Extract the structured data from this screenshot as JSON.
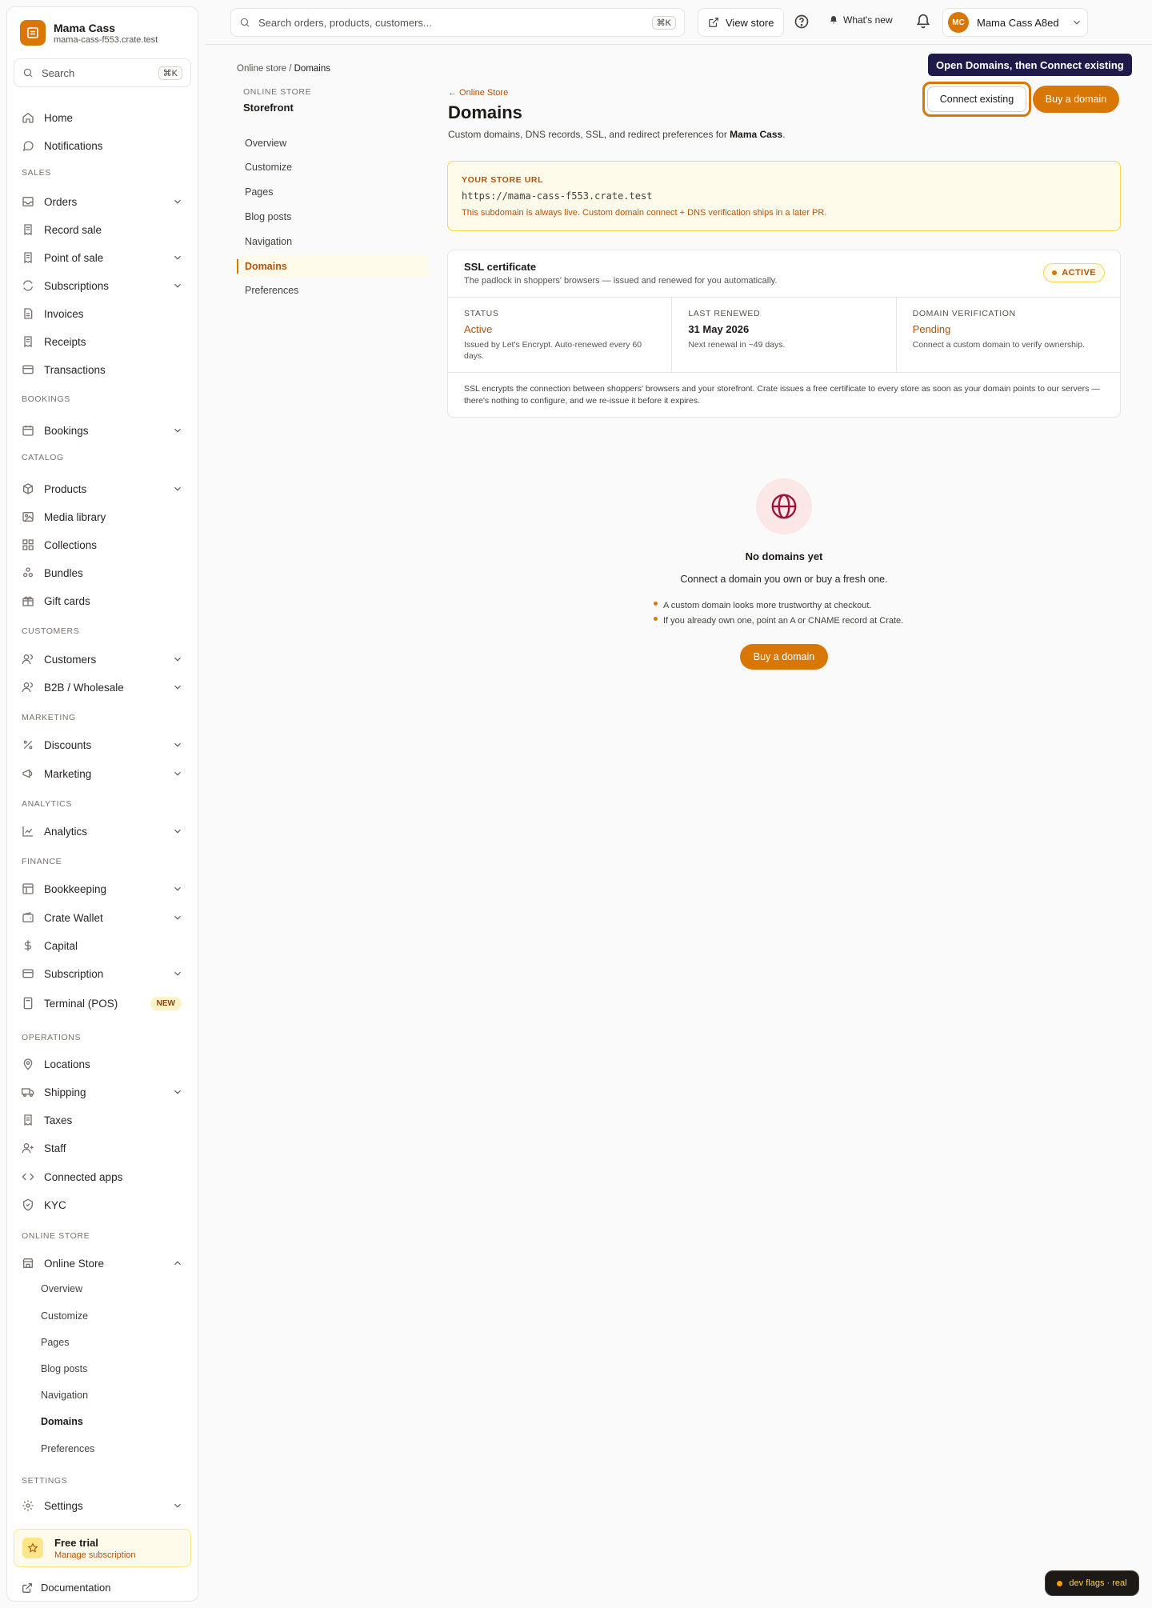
{
  "brand": {
    "name": "Mama Cass",
    "domain": "mama-cass-f553.crate.test"
  },
  "sidebar": {
    "search_placeholder": "Search",
    "search_kbd": "⌘K",
    "home": "Home",
    "notifications": "Notifications",
    "sales_heading": "SALES",
    "orders": "Orders",
    "record_sale": "Record sale",
    "point_of_sale": "Point of sale",
    "subscriptions": "Subscriptions",
    "invoices": "Invoices",
    "receipts": "Receipts",
    "transactions": "Transactions",
    "bookings_heading": "BOOKINGS",
    "bookings": "Bookings",
    "catalog_heading": "CATALOG",
    "products": "Products",
    "media_library": "Media library",
    "collections": "Collections",
    "bundles": "Bundles",
    "gift_cards": "Gift cards",
    "customers_heading": "CUSTOMERS",
    "customers": "Customers",
    "b2b": "B2B / Wholesale",
    "marketing_heading": "MARKETING",
    "discounts": "Discounts",
    "marketing": "Marketing",
    "analytics_heading": "ANALYTICS",
    "analytics": "Analytics",
    "finance_heading": "FINANCE",
    "bookkeeping": "Bookkeeping",
    "crate_wallet": "Crate Wallet",
    "capital": "Capital",
    "subscription": "Subscription",
    "terminal": "Terminal (POS)",
    "new_badge": "NEW",
    "operations_heading": "OPERATIONS",
    "locations": "Locations",
    "shipping": "Shipping",
    "taxes": "Taxes",
    "staff": "Staff",
    "connected_apps": "Connected apps",
    "kyc": "KYC",
    "online_store_heading": "ONLINE STORE",
    "online_store": "Online Store",
    "os_sub": [
      "Overview",
      "Customize",
      "Pages",
      "Blog posts",
      "Navigation",
      "Domains",
      "Preferences"
    ],
    "settings_heading": "SETTINGS",
    "settings": "Settings",
    "trial_title": "Free trial",
    "trial_link": "Manage subscription",
    "documentation": "Documentation"
  },
  "topbar": {
    "search_placeholder": "Search orders, products, customers...",
    "search_kbd": "⌘K",
    "view_store": "View store",
    "whats_new": "What's new",
    "avatar_initials": "MC",
    "account_name": "Mama Cass A8ed"
  },
  "breadcrumb": {
    "parent": "Online store",
    "sep": "/",
    "current": "Domains"
  },
  "subnav": {
    "heading": "ONLINE STORE",
    "title": "Storefront",
    "items": [
      "Overview",
      "Customize",
      "Pages",
      "Blog posts",
      "Navigation",
      "Domains",
      "Preferences"
    ]
  },
  "page": {
    "back_link": "← Online Store",
    "title": "Domains",
    "desc_prefix": "Custom domains, DNS records, SSL, and redirect preferences for ",
    "desc_store": "Mama Cass",
    "desc_suffix": ".",
    "tooltip": "Open Domains, then Connect existing",
    "connect_existing": "Connect existing",
    "buy_domain": "Buy a domain"
  },
  "store_url": {
    "heading": "YOUR STORE URL",
    "url": "https://mama-cass-f553.crate.test",
    "note": "This subdomain is always live. Custom domain connect + DNS verification ships in a later PR."
  },
  "ssl": {
    "title": "SSL certificate",
    "subtitle": "The padlock in shoppers' browsers — issued and renewed for you automatically.",
    "badge": "ACTIVE",
    "status_label": "STATUS",
    "status_value": "Active",
    "status_note": "Issued by Let's Encrypt. Auto-renewed every 60 days.",
    "renewed_label": "LAST RENEWED",
    "renewed_value": "31 May 2026",
    "renewed_note": "Next renewal in ~49 days.",
    "verify_label": "DOMAIN VERIFICATION",
    "verify_value": "Pending",
    "verify_note": "Connect a custom domain to verify ownership.",
    "footer": "SSL encrypts the connection between shoppers' browsers and your storefront. Crate issues a free certificate to every store as soon as your domain points to our servers — there's nothing to configure, and we re-issue it before it expires."
  },
  "empty": {
    "title": "No domains yet",
    "subtitle": "Connect a domain you own or buy a fresh one.",
    "bullets": [
      "A custom domain looks more trustworthy at checkout.",
      "If you already own one, point an A or CNAME record at Crate."
    ],
    "cta": "Buy a domain"
  },
  "dev_flags": "dev flags · real",
  "colors": {
    "accent": "#d97706",
    "accent_text": "#b45309",
    "tooltip_bg": "#1e1b4b",
    "warn_bg": "#fffbeb"
  }
}
